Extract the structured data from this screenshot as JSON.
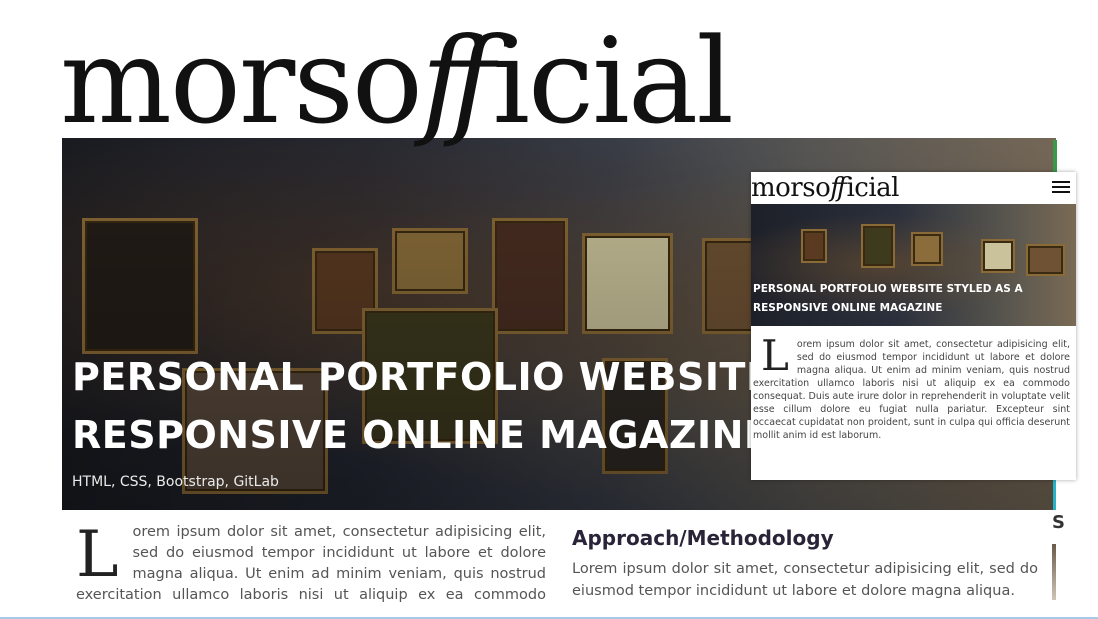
{
  "site": {
    "logo_text_start": "morso",
    "logo_text_ff": "ff",
    "logo_text_end": "icial"
  },
  "hero": {
    "title_line1": "PERSONAL PORTFOLIO WEBSITE STYLED AS A",
    "title_line2": "RESPONSIVE ONLINE MAGAZINE",
    "tags": "HTML, CSS, Bootstrap, GitLab"
  },
  "intro": {
    "dropcap": "L",
    "text": "orem ipsum dolor sit amet, consectetur adipisicing elit, sed do eiusmod tempor incididunt ut labore et dolore magna aliqua. Ut enim ad minim veniam, quis nostrud exercitation ullamco laboris nisi ut aliquip ex ea commodo consequat."
  },
  "approach": {
    "title": "Approach/Methodology",
    "text": "Lorem ipsum dolor sit amet, consectetur adipisicing elit, sed do eiusmod tempor incididunt ut labore et dolore magna aliqua."
  },
  "side_letter": "S",
  "mobile": {
    "logo_text_start": "morso",
    "logo_text_ff": "ff",
    "logo_text_end": "icial",
    "menu_icon": "hamburger-icon",
    "title": "PERSONAL PORTFOLIO WEBSITE STYLED AS A RESPONSIVE ONLINE MAGAZINE",
    "dropcap": "L",
    "text": "orem ipsum dolor sit amet, consectetur adipisicing elit, sed do eiusmod tempor incididunt ut labore et dolore magna aliqua. Ut enim ad minim veniam, quis nostrud exercitation ullamco laboris nisi ut aliquip ex ea commodo consequat. Duis aute irure dolor in reprehenderit in voluptate velit esse cillum dolore eu fugiat nulla pariatur. Excepteur sint occaecat cupidatat non proident, sunt in culpa qui officia deserunt mollit anim id est laborum."
  },
  "colors": {
    "accent_green": "#3a9a4a",
    "accent_cyan": "#27b3c7"
  }
}
